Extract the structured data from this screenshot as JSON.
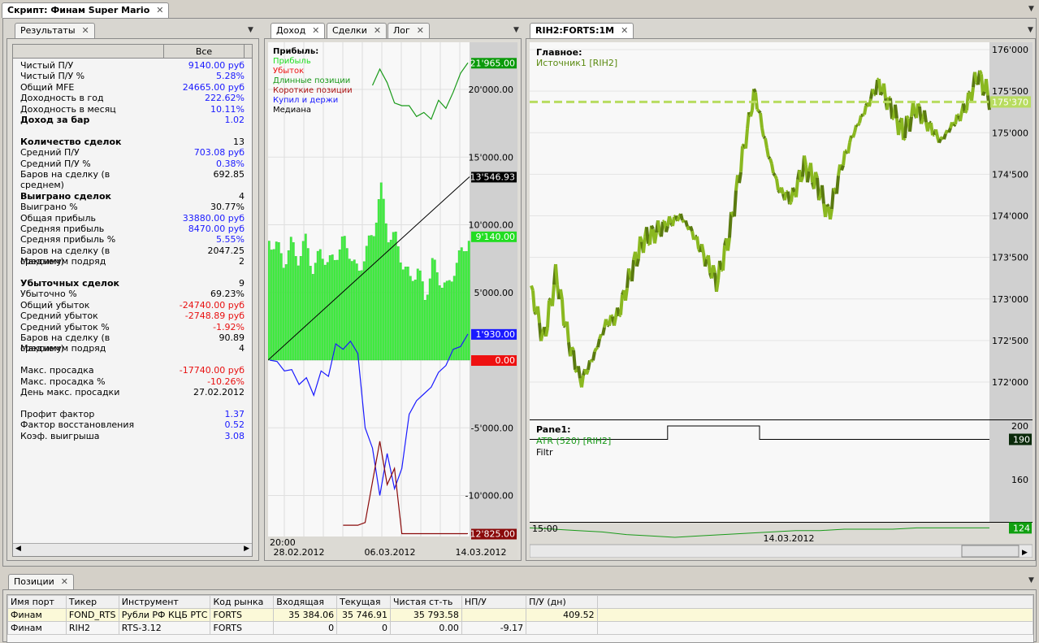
{
  "window": {
    "tab": "Скрипт: Финам Super Mario"
  },
  "results": {
    "tab": "Результаты",
    "column": "Все",
    "rows": [
      {
        "k": "Чистый П/У",
        "v": "9140.00 руб",
        "c": "blue"
      },
      {
        "k": "Чистый П/У %",
        "v": "5.28%",
        "c": "blue"
      },
      {
        "k": "Общий MFE",
        "v": "24665.00 руб",
        "c": "blue"
      },
      {
        "k": "Доходность в год",
        "v": "222.62%",
        "c": "blue"
      },
      {
        "k": "Доходность в месяц",
        "v": "10.11%",
        "c": "blue"
      },
      {
        "k": "Доход за бар",
        "v": "1.02",
        "c": "blue",
        "b": true
      },
      {
        "k": "",
        "v": ""
      },
      {
        "k": "Количество сделок",
        "v": "13",
        "b": true
      },
      {
        "k": "Средний П/У",
        "v": "703.08 руб",
        "c": "blue"
      },
      {
        "k": "Средний П/У %",
        "v": "0.38%",
        "c": "blue"
      },
      {
        "k": "Баров на сделку (в среднем)",
        "v": "692.85"
      },
      {
        "k": "",
        "v": ""
      },
      {
        "k": "Выиграно сделок",
        "v": "4",
        "b": true
      },
      {
        "k": "Выиграно %",
        "v": "30.77%"
      },
      {
        "k": "Общая прибыль",
        "v": "33880.00 руб",
        "c": "blue"
      },
      {
        "k": "Средняя прибыль",
        "v": "8470.00 руб",
        "c": "blue"
      },
      {
        "k": "Средняя прибыль %",
        "v": "5.55%",
        "c": "blue"
      },
      {
        "k": "Баров на сделку (в среднем)",
        "v": "2047.25"
      },
      {
        "k": "Максимум подряд",
        "v": "2"
      },
      {
        "k": "",
        "v": ""
      },
      {
        "k": "Убыточных сделок",
        "v": "9",
        "b": true
      },
      {
        "k": "Убыточно %",
        "v": "69.23%"
      },
      {
        "k": "Общий убыток",
        "v": "-24740.00 руб",
        "c": "red"
      },
      {
        "k": "Средний убыток",
        "v": "-2748.89 руб",
        "c": "red"
      },
      {
        "k": "Средний убыток %",
        "v": "-1.92%",
        "c": "red"
      },
      {
        "k": "Баров на сделку (в среднем)",
        "v": "90.89"
      },
      {
        "k": "Максимум подряд",
        "v": "4"
      },
      {
        "k": "",
        "v": ""
      },
      {
        "k": "Макс. просадка",
        "v": "-17740.00 руб",
        "c": "red"
      },
      {
        "k": "Макс. просадка %",
        "v": "-10.26%",
        "c": "red"
      },
      {
        "k": "День макс. просадки",
        "v": "27.02.2012"
      },
      {
        "k": "",
        "v": ""
      },
      {
        "k": "Профит фактор",
        "v": "1.37",
        "c": "blue"
      },
      {
        "k": "Фактор восстановления",
        "v": "0.52",
        "c": "blue"
      },
      {
        "k": "Коэф. выигрыша",
        "v": "3.08",
        "c": "blue"
      }
    ]
  },
  "equity": {
    "tabs": [
      "Доход",
      "Сделки",
      "Лог"
    ],
    "legend": {
      "title": "Прибыль:",
      "items": [
        {
          "t": "Прибыль",
          "c": "#22dd22"
        },
        {
          "t": "Убыток",
          "c": "#ee1111"
        },
        {
          "t": "Длинные позиции",
          "c": "#1a9a1a"
        },
        {
          "t": "Короткие позиции",
          "c": "#aa1111"
        },
        {
          "t": "Купил и держи",
          "c": "#1a1aff"
        },
        {
          "t": "Медиана",
          "c": "#000"
        }
      ]
    },
    "yticks": [
      "20'000.00",
      "15'000.00",
      "10'000.00",
      "5'000.00",
      "0.00",
      "-5'000.00",
      "-10'000.00"
    ],
    "badges": [
      {
        "t": "21'965.00",
        "v": 21965,
        "c": "#0a9a0a"
      },
      {
        "t": "13'546.93",
        "v": 13546.93,
        "c": "#000"
      },
      {
        "t": "9'140.00",
        "v": 9140,
        "c": "#22dd22"
      },
      {
        "t": "1'930.00",
        "v": 1930,
        "c": "#1a1aff"
      },
      {
        "t": "0.00",
        "v": 0,
        "c": "#ee1111"
      },
      {
        "t": "-12'825.00",
        "v": -12825,
        "c": "#8a0a0a"
      }
    ],
    "xlabels": {
      "time": "20:00",
      "dates": [
        "28.02.2012",
        "06.03.2012",
        "14.03.2012"
      ]
    },
    "chart_data": {
      "type": "line",
      "ylim": [
        -12000,
        23000
      ],
      "profit": [
        8800,
        8500,
        7200,
        8600,
        7500,
        8900,
        6500,
        8200,
        7000,
        7800,
        8800,
        7900,
        6200,
        8200,
        9100,
        12900,
        9300,
        9000,
        7200,
        5900,
        6800,
        4600,
        7200,
        6000,
        5200,
        6900,
        8000,
        9140
      ],
      "long": [
        null,
        null,
        null,
        null,
        null,
        null,
        null,
        null,
        null,
        null,
        null,
        null,
        null,
        null,
        20300,
        21500,
        20500,
        19000,
        18800,
        18800,
        18000,
        18300,
        17800,
        19200,
        18600,
        19800,
        21200,
        21965
      ],
      "blue": [
        0,
        -100,
        -800,
        -700,
        -1800,
        -1300,
        -2600,
        -800,
        -1200,
        1200,
        800,
        1400,
        500,
        -5000,
        -6500,
        -10000,
        -6900,
        -9500,
        -8000,
        -4000,
        -3000,
        -2500,
        -2000,
        -900,
        -400,
        800,
        1000,
        1930
      ],
      "short": [
        null,
        null,
        null,
        null,
        null,
        null,
        null,
        null,
        null,
        null,
        -12200,
        -12200,
        -12200,
        -12000,
        -9000,
        -6000,
        -9200,
        -8000,
        -12825,
        -12825,
        -12825,
        -12825,
        -12825,
        -12825,
        -12825,
        -12825,
        -12825,
        -12825
      ],
      "median": [
        0,
        13546.93
      ]
    }
  },
  "price": {
    "tab": "RIH2:FORTS:1M",
    "main_label": "Главное:",
    "source": "Источник1 [RIH2]",
    "yticks": [
      "176'000",
      "175'500",
      "175'000",
      "174'500",
      "174'000",
      "173'500",
      "173'000",
      "172'500",
      "172'000"
    ],
    "last": "175'370",
    "pane_label": "Pane1:",
    "atr": "ATR (520) [RIH2]",
    "filtr": "Filtr",
    "pane_ticks": [
      "200",
      "160"
    ],
    "pane_badges": [
      "190",
      "124"
    ],
    "xlabels": {
      "time": "15:00",
      "date": "14.03.2012"
    },
    "chart_data": {
      "type": "line",
      "ylim": [
        171700,
        176200
      ],
      "last_value": 175370,
      "values": [
        173100,
        172500,
        173300,
        172500,
        172000,
        172300,
        172700,
        172800,
        173300,
        173700,
        173800,
        173900,
        174000,
        173800,
        173500,
        173200,
        173800,
        174700,
        175500,
        174800,
        174300,
        174200,
        174600,
        174400,
        174000,
        174600,
        175000,
        175300,
        175600,
        175300,
        175000,
        175300,
        175100,
        174900,
        175100,
        175300,
        175700,
        175400
      ],
      "atr": [
        124,
        123,
        122,
        121,
        119,
        118,
        117,
        118,
        119,
        120,
        121,
        122,
        122,
        123,
        123,
        123,
        124,
        124,
        124,
        124
      ],
      "filtr_steps": [
        190,
        190,
        190,
        190,
        190,
        190,
        200,
        200,
        200,
        200,
        190,
        190,
        190,
        190,
        190,
        190,
        190,
        190,
        190,
        190
      ]
    }
  },
  "positions": {
    "tab": "Позиции",
    "columns": [
      "Имя порт",
      "Тикер",
      "Инструмент",
      "Код рынка",
      "Входящая",
      "Текущая",
      "Чистая ст-ть",
      "НП/У",
      "П/У (дн)"
    ],
    "rows": [
      [
        "Финам",
        "FOND_RTS",
        "Рубли РФ КЦБ РТС",
        "FORTS",
        "35 384.06",
        "35 746.91",
        "35 793.58",
        "",
        "409.52"
      ],
      [
        "Финам",
        "RIH2",
        "RTS-3.12",
        "FORTS",
        "0",
        "0",
        "0.00",
        "-9.17",
        ""
      ]
    ]
  }
}
